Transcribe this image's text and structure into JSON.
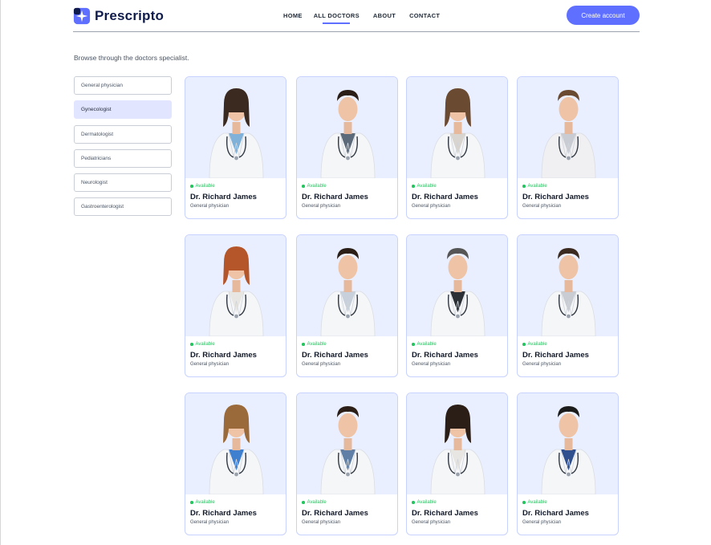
{
  "brand": {
    "name": "Prescripto"
  },
  "nav": {
    "items": [
      "HOME",
      "ALL DOCTORS",
      "ABOUT",
      "CONTACT"
    ],
    "active_index": 1
  },
  "cta": {
    "label": "Create account"
  },
  "colors": {
    "accent": "#5f6fff",
    "available": "#22c55e",
    "photo_bg": "#eaefff",
    "filter_active": "#e2e5ff"
  },
  "page": {
    "subtitle": "Browse through the doctors specialist."
  },
  "filters": {
    "items": [
      "General physician",
      "Gynecologist",
      "Dermatologist",
      "Pediatricians",
      "Neurologist",
      "Gastroenterologist"
    ],
    "active_index": 1
  },
  "doctors": [
    {
      "status": "Available",
      "name": "Dr. Richard James",
      "speciality": "General physician",
      "gender": "female",
      "hair": "#3b2a20",
      "coat": "#f5f6f8",
      "inner": "#7fb1d9"
    },
    {
      "status": "Available",
      "name": "Dr. Richard James",
      "speciality": "General physician",
      "gender": "male",
      "hair": "#2a1e17",
      "coat": "#f5f6f8",
      "inner": "#5c6a7a"
    },
    {
      "status": "Available",
      "name": "Dr. Richard James",
      "speciality": "General physician",
      "gender": "female",
      "hair": "#6b4a32",
      "coat": "#f5f6f8",
      "inner": "#d8d4cf"
    },
    {
      "status": "Available",
      "name": "Dr. Richard James",
      "speciality": "General physician",
      "gender": "male",
      "hair": "#6b4a32",
      "coat": "#f0f0f2",
      "inner": "#c9cdd3"
    },
    {
      "status": "Available",
      "name": "Dr. Richard James",
      "speciality": "General physician",
      "gender": "female",
      "hair": "#b5562a",
      "coat": "#f5f6f8",
      "inner": "#e8e6e3"
    },
    {
      "status": "Available",
      "name": "Dr. Richard James",
      "speciality": "General physician",
      "gender": "male",
      "hair": "#2a1e17",
      "coat": "#f5f6f8",
      "inner": "#c7d0db"
    },
    {
      "status": "Available",
      "name": "Dr. Richard James",
      "speciality": "General physician",
      "gender": "male",
      "hair": "#555555",
      "coat": "#f5f6f8",
      "inner": "#2b2f36"
    },
    {
      "status": "Available",
      "name": "Dr. Richard James",
      "speciality": "General physician",
      "gender": "male",
      "hair": "#3b2a20",
      "coat": "#f5f6f8",
      "inner": "#c9cdd3"
    },
    {
      "status": "Available",
      "name": "Dr. Richard James",
      "speciality": "General physician",
      "gender": "female",
      "hair": "#9a6a3a",
      "coat": "#f5f6f8",
      "inner": "#3f7fd0"
    },
    {
      "status": "Available",
      "name": "Dr. Richard James",
      "speciality": "General physician",
      "gender": "male",
      "hair": "#2a1e17",
      "coat": "#f5f6f8",
      "inner": "#5f7fa6"
    },
    {
      "status": "Available",
      "name": "Dr. Richard James",
      "speciality": "General physician",
      "gender": "female",
      "hair": "#2a1e17",
      "coat": "#f5f6f8",
      "inner": "#e8e6e3"
    },
    {
      "status": "Available",
      "name": "Dr. Richard James",
      "speciality": "General physician",
      "gender": "male",
      "hair": "#1b1b1b",
      "coat": "#f5f6f8",
      "inner": "#2f4f8f"
    }
  ]
}
